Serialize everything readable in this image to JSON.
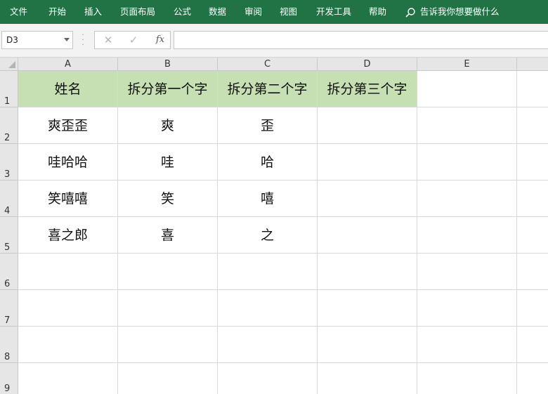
{
  "ribbon": {
    "tabs": [
      "文件",
      "开始",
      "插入",
      "页面布局",
      "公式",
      "数据",
      "审阅",
      "视图",
      "开发工具",
      "帮助"
    ],
    "tell_me": "告诉我你想要做什么",
    "bar_color": "#217346"
  },
  "formula_bar": {
    "name_box": "D3",
    "cancel_symbol": "✕",
    "enter_symbol": "✓",
    "fx_label": "fx",
    "formula_value": ""
  },
  "sheet": {
    "columns": [
      "A",
      "B",
      "C",
      "D",
      "E"
    ],
    "selected_column": "D",
    "rows": [
      "1",
      "2",
      "3",
      "4",
      "5",
      "6",
      "7",
      "8",
      "9"
    ],
    "header_fill": "#c6e0b4",
    "cells": [
      [
        "姓名",
        "拆分第一个字",
        "拆分第二个字",
        "拆分第三个字",
        ""
      ],
      [
        "爽歪歪",
        "爽",
        "歪",
        "",
        ""
      ],
      [
        "哇哈哈",
        "哇",
        "哈",
        "",
        ""
      ],
      [
        "笑嘻嘻",
        "笑",
        "嘻",
        "",
        ""
      ],
      [
        "喜之郎",
        "喜",
        "之",
        "",
        ""
      ]
    ]
  }
}
